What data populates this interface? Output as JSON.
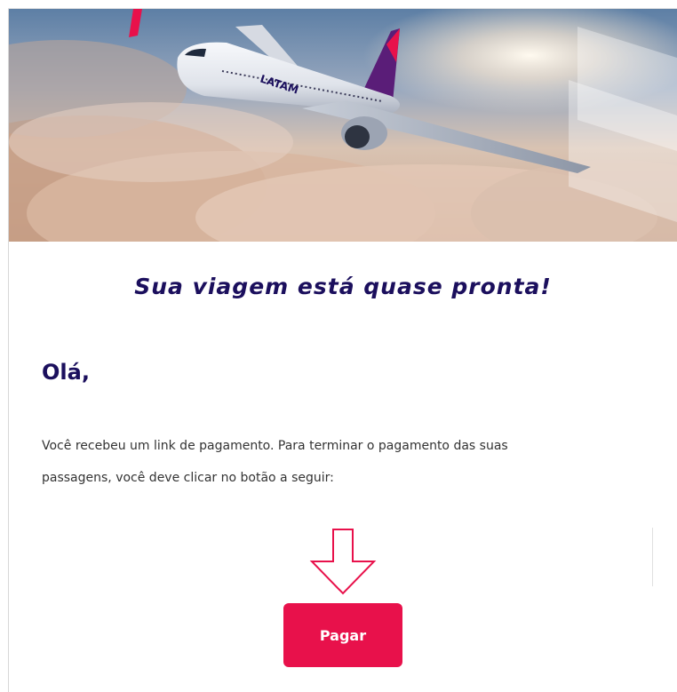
{
  "hero": {
    "logo_text": "LATAM",
    "image_alt_icon": "airplane-over-clouds-image"
  },
  "email": {
    "headline": "Sua viagem está quase pronta!",
    "greeting": "Olá,",
    "body_line_1": "Você recebeu um link de pagamento. Para terminar o pagamento das suas",
    "body_line_2": "passagens, você deve clicar no botão a seguir:",
    "pay_button_label": "Pagar"
  },
  "colors": {
    "brand_navy": "#1b0f5d",
    "brand_red": "#e8114b",
    "arrow_stroke": "#e8114b",
    "body_text": "#333333"
  },
  "icons": {
    "arrow": "down-arrow-outline-icon"
  }
}
